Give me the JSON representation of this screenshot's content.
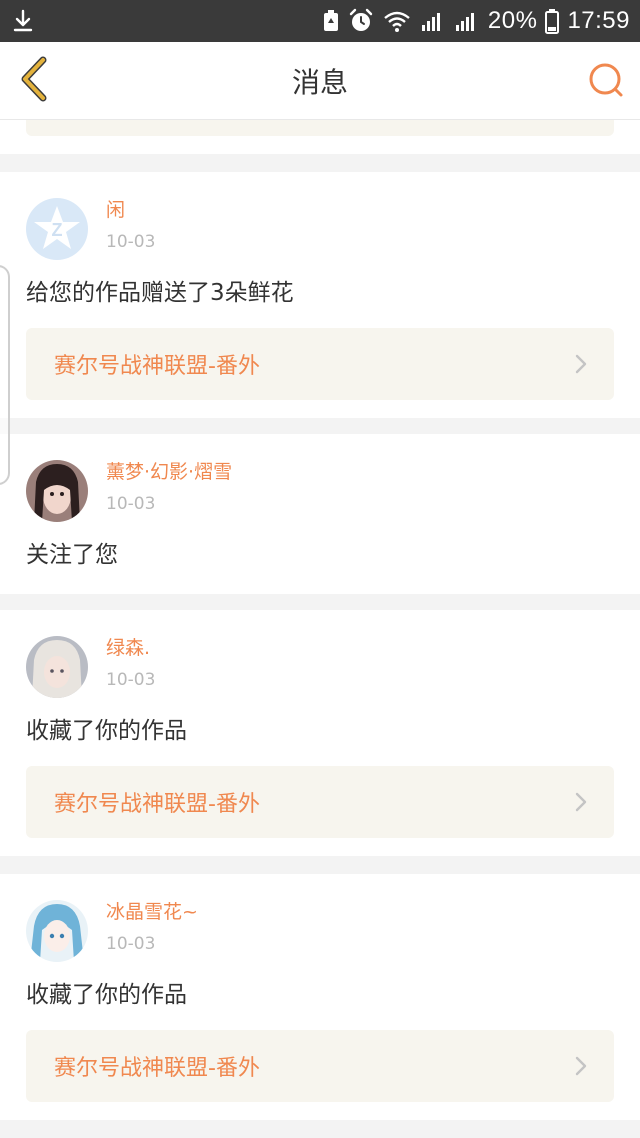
{
  "status_bar": {
    "download_icon": "download-icon",
    "battery_percent": "20%",
    "time": "17:59"
  },
  "header": {
    "title": "消息",
    "back_icon": "back-icon",
    "search_icon": "search-icon"
  },
  "colors": {
    "accent": "#f0884f",
    "back_arrow": "#e3b23c",
    "link_bg": "#f7f5ee",
    "date": "#b8b8b8",
    "text": "#333333"
  },
  "messages": [
    {
      "username": "闲",
      "date": "10-03",
      "text": "给您的作品赠送了3朵鲜花",
      "work": "赛尔号战神联盟-番外"
    },
    {
      "username": "薰梦·幻影·熠雪",
      "date": "10-03",
      "text": "关注了您"
    },
    {
      "username": "绿森.",
      "date": "10-03",
      "text": "收藏了你的作品",
      "work": "赛尔号战神联盟-番外"
    },
    {
      "username": "冰晶雪花~",
      "date": "10-03",
      "text": "收藏了你的作品",
      "work": "赛尔号战神联盟-番外"
    }
  ]
}
